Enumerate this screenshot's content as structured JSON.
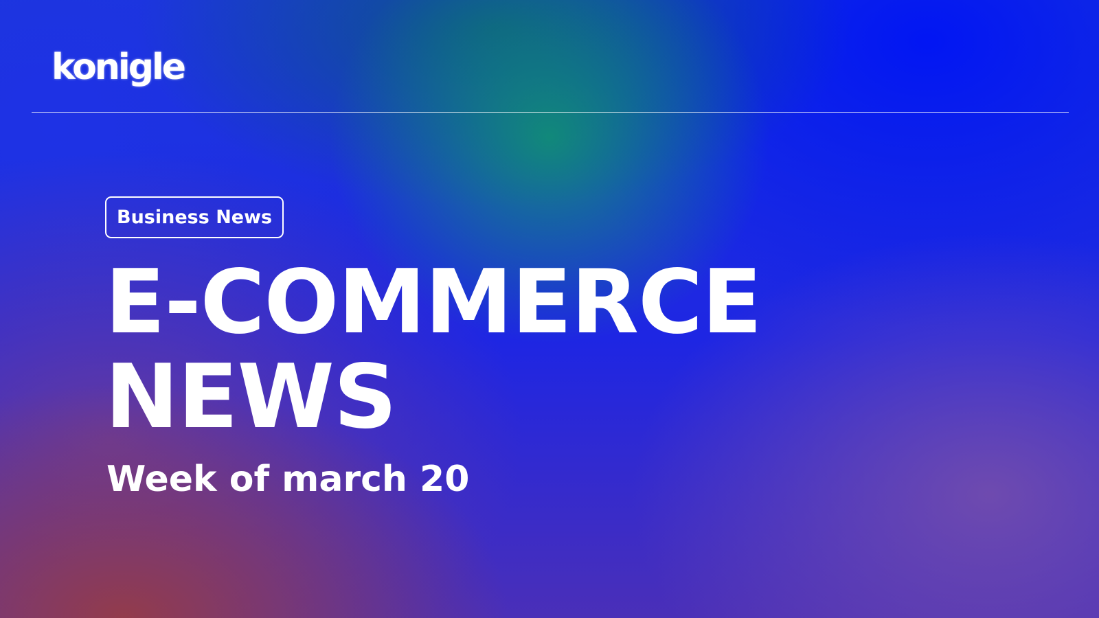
{
  "brand": {
    "logo_text": "konigle"
  },
  "hero": {
    "tag_label": "Business News",
    "headline_line1": "E-COMMERCE",
    "headline_line2": "NEWS",
    "subtitle": "Week of march 20"
  },
  "colors": {
    "text": "#ffffff",
    "background_primary": "#1a22e0",
    "background_teal_glow": "#10966e",
    "background_warm_corner": "#963c46",
    "background_violet": "#6e3c96"
  }
}
